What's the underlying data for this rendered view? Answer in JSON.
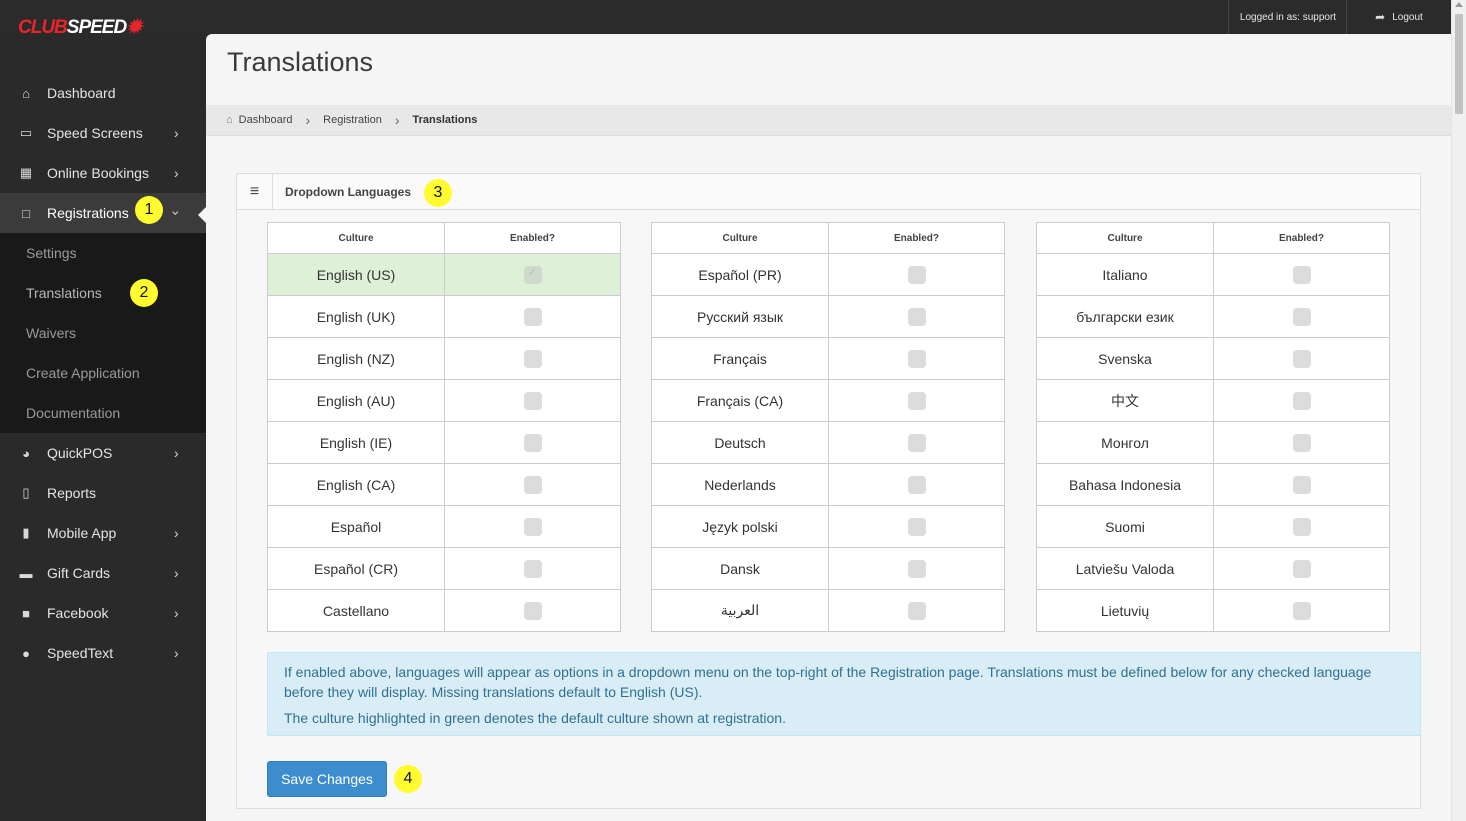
{
  "app": {
    "logo_club": "CLUB",
    "logo_speed": "SPEED",
    "logged_in_text": "Logged in as: support",
    "logout_label": "Logout"
  },
  "sidebar": {
    "items": [
      {
        "label": "Dashboard",
        "icon": "home-icon",
        "has_chevron": false
      },
      {
        "label": "Speed Screens",
        "icon": "desktop-icon",
        "has_chevron": true
      },
      {
        "label": "Online Bookings",
        "icon": "calendar-icon",
        "has_chevron": true
      },
      {
        "label": "Registrations",
        "icon": "square-icon",
        "has_chevron": true,
        "active": true
      },
      {
        "label": "QuickPOS",
        "icon": "gauge-icon",
        "has_chevron": true
      },
      {
        "label": "Reports",
        "icon": "file-icon",
        "has_chevron": false
      },
      {
        "label": "Mobile App",
        "icon": "mobile-icon",
        "has_chevron": true
      },
      {
        "label": "Gift Cards",
        "icon": "credit-card-icon",
        "has_chevron": true
      },
      {
        "label": "Facebook",
        "icon": "facebook-icon",
        "has_chevron": true
      },
      {
        "label": "SpeedText",
        "icon": "chat-icon",
        "has_chevron": true
      }
    ],
    "subitems": [
      "Settings",
      "Translations",
      "Waivers",
      "Create Application",
      "Documentation"
    ]
  },
  "page": {
    "title": "Translations",
    "breadcrumb": [
      "Dashboard",
      "Registration",
      "Translations"
    ]
  },
  "panel": {
    "title": "Dropdown Languages",
    "column_culture": "Culture",
    "column_enabled": "Enabled?",
    "tables": [
      [
        "English (US)",
        "English (UK)",
        "English (NZ)",
        "English (AU)",
        "English (IE)",
        "English (CA)",
        "Español",
        "Español (CR)",
        "Castellano"
      ],
      [
        "Español (PR)",
        "Русский язык",
        "Français",
        "Français (CA)",
        "Deutsch",
        "Nederlands",
        "Język polski",
        "Dansk",
        "العربية"
      ],
      [
        "Italiano",
        "български език",
        "Svenska",
        "中文",
        "Монгол",
        "Bahasa Indonesia",
        "Suomi",
        "Latviešu Valoda",
        "Lietuvių"
      ]
    ],
    "default_culture": "English (US)",
    "info_text_1": "If enabled above, languages will appear as options in a dropdown menu on the top-right of the Registration page. Translations must be defined below for any checked language before they will display. Missing translations default to English (US).",
    "info_text_2": "The culture highlighted in green denotes the default culture shown at registration.",
    "save_label": "Save Changes"
  },
  "markers": [
    "1",
    "2",
    "3",
    "4"
  ],
  "colors": {
    "accent_red": "#e8252b",
    "button_blue": "#3c8dce",
    "default_green": "#dff0d8",
    "info_blue": "#d9edf7",
    "marker_yellow": "#fffb2e"
  }
}
